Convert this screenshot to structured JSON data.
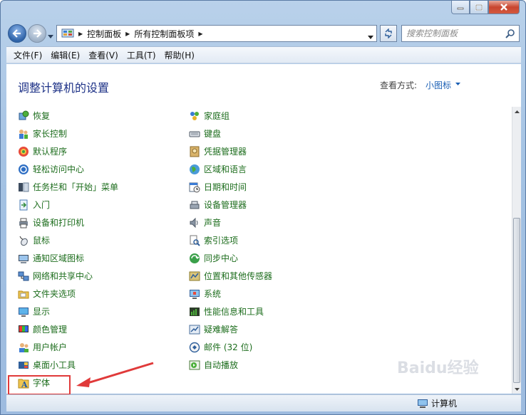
{
  "window": {
    "controls": {
      "minimize_icon": "minimize-icon",
      "maximize_icon": "maximize-icon",
      "close_icon": "close-icon"
    }
  },
  "address_bar": {
    "crumbs": [
      "控制面板",
      "所有控制面板项"
    ]
  },
  "search": {
    "placeholder": "搜索控制面板"
  },
  "menu": [
    "文件(F)",
    "编辑(E)",
    "查看(V)",
    "工具(T)",
    "帮助(H)"
  ],
  "main": {
    "title": "调整计算机的设置",
    "view_by_label": "查看方式:",
    "view_by_value": "小图标"
  },
  "items_left": [
    "恢复",
    "家长控制",
    "默认程序",
    "轻松访问中心",
    "任务栏和「开始」菜单",
    "入门",
    "设备和打印机",
    "鼠标",
    "通知区域图标",
    "网络和共享中心",
    "文件夹选项",
    "显示",
    "颜色管理",
    "用户帐户",
    "桌面小工具",
    "字体"
  ],
  "items_right": [
    "家庭组",
    "键盘",
    "凭据管理器",
    "区域和语言",
    "日期和时间",
    "设备管理器",
    "声音",
    "索引选项",
    "同步中心",
    "位置和其他传感器",
    "系统",
    "性能信息和工具",
    "疑难解答",
    "邮件 (32 位)",
    "自动播放"
  ],
  "status_bar": {
    "computer_label": "计算机"
  },
  "watermark": "Baidu经验",
  "colors": {
    "link_green": "#1d6d1d",
    "title_blue": "#1e3287",
    "annotation_red": "#e03a3a"
  }
}
